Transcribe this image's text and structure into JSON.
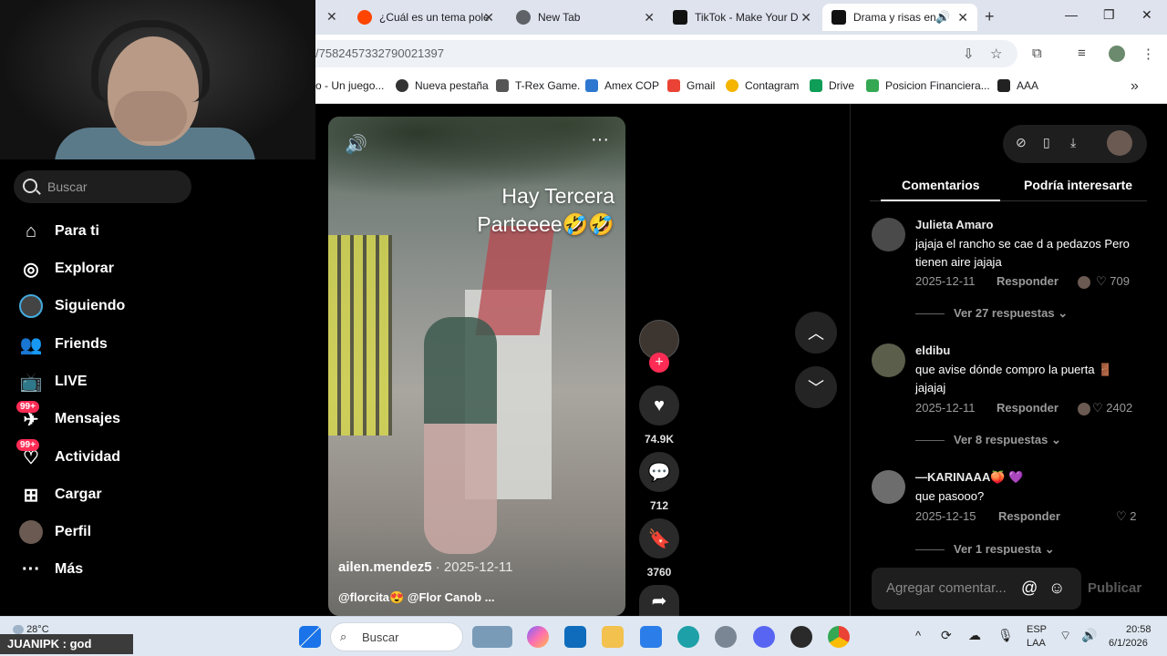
{
  "browser": {
    "tabs": [
      {
        "label": "¿Cuál es un tema pole",
        "icon": "reddit-icon"
      },
      {
        "label": "New Tab",
        "icon": "chrome-icon"
      },
      {
        "label": "TikTok - Make Your D",
        "icon": "tiktok-icon"
      },
      {
        "label": "Drama y risas en",
        "icon": "tiktok-icon"
      }
    ],
    "url": "/7582457332790021397",
    "bookmarks": [
      "o - Un juego...",
      "Nueva pestaña",
      "T-Rex Game.",
      "Amex COP",
      "Gmail",
      "Contagram",
      "Drive",
      "Posicion Financiera...",
      "AAA"
    ]
  },
  "sidebar": {
    "search_placeholder": "Buscar",
    "items": [
      {
        "label": "Para ti",
        "icon": "home-icon"
      },
      {
        "label": "Explorar",
        "icon": "compass-icon"
      },
      {
        "label": "Siguiendo",
        "icon": "following-avatar-icon"
      },
      {
        "label": "Friends",
        "icon": "friends-icon"
      },
      {
        "label": "LIVE",
        "icon": "live-tv-icon"
      },
      {
        "label": "Mensajes",
        "icon": "message-icon",
        "badge": "99+"
      },
      {
        "label": "Actividad",
        "icon": "activity-icon",
        "badge": "99+"
      },
      {
        "label": "Cargar",
        "icon": "upload-icon"
      },
      {
        "label": "Perfil",
        "icon": "profile-avatar-icon"
      },
      {
        "label": "Más",
        "icon": "more-dots-icon"
      }
    ]
  },
  "video": {
    "caption_line1": "Hay Tercera",
    "caption_line2": "Parteeee🤣🤣",
    "username": "ailen.mendez5",
    "date": "· 2025-12-11",
    "tags": "@florcita😍 @Flor Canob ..."
  },
  "actions": {
    "likes": "74.9K",
    "comments": "712",
    "saves": "3760"
  },
  "comments_panel": {
    "tab_comments": "Comentarios",
    "tab_suggested": "Podría interesarte",
    "comments": [
      {
        "name": "Julieta Amaro",
        "text": "jajaja el rancho se cae d a pedazos Pero tienen aire jajaja",
        "date": "2025-12-11",
        "reply": "Responder",
        "likes": "709",
        "more": "Ver 27 respuestas"
      },
      {
        "name": "eldibu",
        "text": "que avise dónde compro la puerta 🚪 jajajaj",
        "date": "2025-12-11",
        "reply": "Responder",
        "likes": "2402",
        "more": "Ver 8 respuestas"
      },
      {
        "name": "—KARINAAA🍑 💜",
        "text": "que pasooo?",
        "date": "2025-12-15",
        "reply": "Responder",
        "likes": "2",
        "more": "Ver 1 respuesta"
      }
    ],
    "add_placeholder": "Agregar comentar...",
    "publish": "Publicar"
  },
  "taskbar": {
    "search": "Buscar",
    "weather_temp": "28°C",
    "lang1": "ESP",
    "lang2": "LAA",
    "time": "20:58",
    "date": "6/1/2026",
    "stream_label": "JUANIPK : god"
  }
}
